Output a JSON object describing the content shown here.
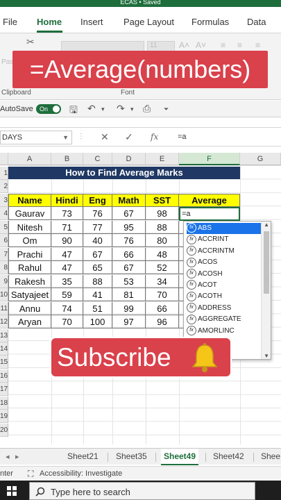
{
  "window": {
    "title": "ECAS • Saved"
  },
  "ribbon_tabs": [
    "File",
    "Home",
    "Insert",
    "Page Layout",
    "Formulas",
    "Data"
  ],
  "ribbon_active_tab": "Home",
  "ribbon": {
    "clipboard_label": "Clipboard",
    "font_label": "Font",
    "paste_label": "Pas",
    "font_size": "11"
  },
  "overlay_title": "=Average(numbers)",
  "qat": {
    "autosave_label": "AutoSave",
    "toggle_label": "On"
  },
  "formula_bar": {
    "name_box": "DAYS",
    "fx": "fx",
    "value": "=a"
  },
  "columns": [
    "A",
    "B",
    "C",
    "D",
    "E",
    "F",
    "G"
  ],
  "row_numbers": [
    "1",
    "2",
    "3",
    "4",
    "5",
    "6",
    "7",
    "8",
    "9",
    "10",
    "11",
    "12",
    "13",
    "14",
    "15",
    "16",
    "17",
    "18",
    "19",
    "20"
  ],
  "sheet": {
    "banner": "How to Find Average Marks",
    "headers": [
      "Name",
      "Hindi",
      "Eng",
      "Math",
      "SST",
      "Average"
    ],
    "rows": [
      [
        "Gaurav",
        "73",
        "76",
        "67",
        "98"
      ],
      [
        "Nitesh",
        "71",
        "77",
        "95",
        "88"
      ],
      [
        "Om",
        "90",
        "40",
        "76",
        "80"
      ],
      [
        "Prachi",
        "47",
        "67",
        "66",
        "48"
      ],
      [
        "Rahul",
        "47",
        "65",
        "67",
        "52"
      ],
      [
        "Rakesh",
        "35",
        "88",
        "53",
        "34"
      ],
      [
        "Satyajeet",
        "59",
        "41",
        "81",
        "70"
      ],
      [
        "Annu",
        "74",
        "51",
        "99",
        "66"
      ],
      [
        "Aryan",
        "70",
        "100",
        "97",
        "96"
      ]
    ],
    "active_cell_value": "=a"
  },
  "autocomplete": {
    "items": [
      "ABS",
      "ACCRINT",
      "ACCRINTM",
      "ACOS",
      "ACOSH",
      "ACOT",
      "ACOTH",
      "ADDRESS",
      "AGGREGATE",
      "AMORLINC"
    ],
    "selected_index": 0,
    "icon_label": "fx"
  },
  "subscribe_banner": "Subscribe",
  "sheet_tabs": [
    "Sheet21",
    "Sheet35",
    "Sheet49",
    "Sheet42",
    "Shee"
  ],
  "active_sheet": "Sheet49",
  "status": {
    "mode": "nter",
    "accessibility": "Accessibility: Investigate"
  },
  "taskbar": {
    "search_placeholder": "Type here to search"
  },
  "colors": {
    "excel_green": "#1e6e3c",
    "banner_navy": "#1f3864",
    "header_yellow": "#ffff00",
    "overlay_red": "#d9414b",
    "selection_blue": "#1a73e8"
  }
}
